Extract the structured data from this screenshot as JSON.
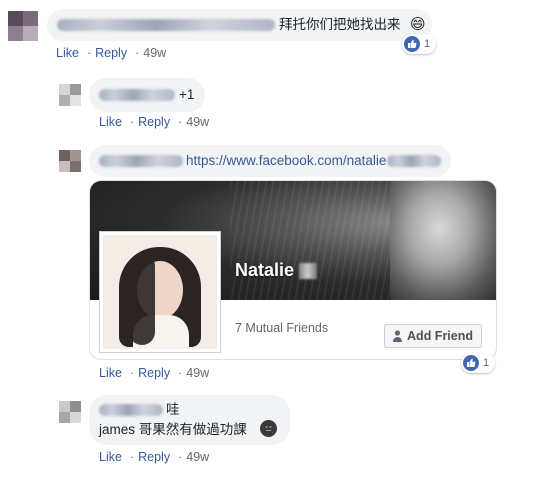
{
  "comments": [
    {
      "text": "拜托你们把她找出来",
      "emoji": "😄",
      "actions": {
        "like": "Like",
        "reply": "Reply",
        "time": "49w"
      },
      "reactions": "1"
    },
    {
      "text": "+1",
      "actions": {
        "like": "Like",
        "reply": "Reply",
        "time": "49w"
      }
    },
    {
      "link_text": "https://www.facebook.com/natalie",
      "card": {
        "name": "Natalie",
        "mutual_friends": "7 Mutual Friends",
        "add_friend_label": "Add Friend"
      },
      "actions": {
        "like": "Like",
        "reply": "Reply",
        "time": "49w"
      },
      "reactions": "1"
    },
    {
      "line1": "哇",
      "line2": "james 哥果然有做過功課",
      "emoji": "😶",
      "actions": {
        "like": "Like",
        "reply": "Reply",
        "time": "49w"
      }
    }
  ],
  "colors": {
    "link": "#385898",
    "bubble": "#f2f3f5",
    "like_blue": "#4267b2",
    "meta_gray": "#606770"
  }
}
